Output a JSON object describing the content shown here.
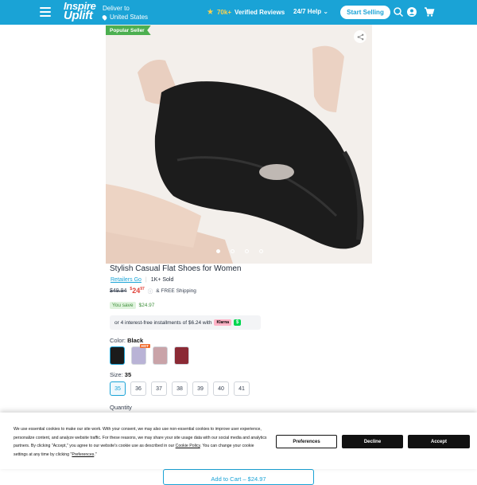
{
  "header": {
    "logo_line1": "Inspire",
    "logo_line2": "Uplift",
    "deliver_label": "Deliver to",
    "deliver_location": "United States",
    "reviews_count": "70k+",
    "reviews_label": "Verified Reviews",
    "help_label": "24/7 Help",
    "start_selling": "Start Selling",
    "accent": "#1aa3d6"
  },
  "product": {
    "badge": "Popular Seller",
    "title": "Stylish Casual Flat Shoes for Women",
    "seller": "Retailers Go",
    "sold": "1K+ Sold",
    "old_price": "$49.94",
    "price_symbol": "$",
    "price_whole": "24",
    "price_cents": "97",
    "shipping": "& FREE Shipping",
    "save_label": "You save",
    "save_amount": "$24.97",
    "installments": "or 4 interest-free installments of $6.24 with",
    "klarna": "Klarna",
    "cashapp": "$",
    "image_dots": 4,
    "active_dot": 0
  },
  "options": {
    "color_label": "Color:",
    "color_value": "Black",
    "hot_badge": "HOT",
    "colors": [
      "#1b1b1b",
      "#b9b3d6",
      "#c9a3a8",
      "#8b2a35"
    ],
    "size_label": "Size:",
    "size_value": "35",
    "sizes": [
      "35",
      "36",
      "37",
      "38",
      "39",
      "40",
      "41"
    ],
    "quantity_label": "Quantity"
  },
  "cookie": {
    "text_1": "We use essential cookies to make our site work. With your consent, we may also use non-essential cookies to improve user experience, personalize content, and analyze website traffic. For these reasons, we may share your site usage data with our social media and analytics partners. By clicking \"Accept,\" you agree to our website's cookie use as described in our",
    "policy_link": "Cookie Policy",
    "text_2": ". You can change your cookie settings at any time by clicking \"",
    "preferences_link": "Preferences",
    "text_3": ".\"",
    "preferences_btn": "Preferences",
    "decline_btn": "Decline",
    "accept_btn": "Accept"
  },
  "cart": {
    "add_label": "Add to Cart – $24.97"
  }
}
